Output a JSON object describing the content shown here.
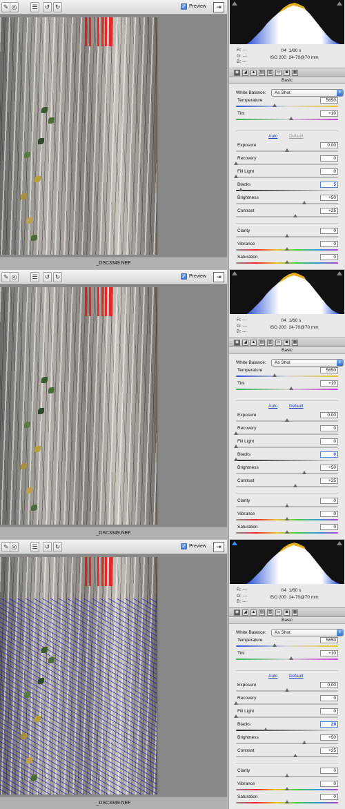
{
  "toolbar": {
    "preview_label": "Preview",
    "preview_checked": true
  },
  "filename": "_DSC3349.NEF",
  "meta": {
    "r": "R:  ---",
    "g": "G:  ---",
    "b": "B:  ---",
    "aperture": "f/4",
    "shutter": "1/60 s",
    "iso": "ISO 200",
    "lens": "24-70@70 mm"
  },
  "basic": {
    "section_title": "Basic",
    "wb_label": "White Balance:",
    "wb_value": "As Shot",
    "auto_label": "Auto",
    "default_label": "Default"
  },
  "panels": [
    {
      "clip_highlight_warning": false,
      "clip_shadow_warning": false,
      "default_enabled": false,
      "sliders": [
        {
          "label": "Temperature",
          "value": "5650",
          "level": 0.38
        },
        {
          "label": "Tint",
          "value": "+10",
          "level": 0.54
        },
        {
          "label": "Exposure",
          "value": "0.00",
          "level": 0.5
        },
        {
          "label": "Recovery",
          "value": "0",
          "level": 0.0
        },
        {
          "label": "Fill Light",
          "value": "0",
          "level": 0.0
        },
        {
          "label": "Blacks",
          "value": "5",
          "level": 0.05,
          "highlight": true
        },
        {
          "label": "Brightness",
          "value": "+50",
          "level": 0.67
        },
        {
          "label": "Contrast",
          "value": "+25",
          "level": 0.58
        },
        {
          "label": "Clarity",
          "value": "0",
          "level": 0.5
        },
        {
          "label": "Vibrance",
          "value": "0",
          "level": 0.5
        },
        {
          "label": "Saturation",
          "value": "0",
          "level": 0.5
        }
      ]
    },
    {
      "clip_highlight_warning": false,
      "clip_shadow_warning": false,
      "default_enabled": true,
      "sliders": [
        {
          "label": "Temperature",
          "value": "5650",
          "level": 0.38
        },
        {
          "label": "Tint",
          "value": "+10",
          "level": 0.54
        },
        {
          "label": "Exposure",
          "value": "0.00",
          "level": 0.5
        },
        {
          "label": "Recovery",
          "value": "0",
          "level": 0.0
        },
        {
          "label": "Fill Light",
          "value": "0",
          "level": 0.0
        },
        {
          "label": "Blacks",
          "value": "0",
          "level": 0.0,
          "highlight": true
        },
        {
          "label": "Brightness",
          "value": "+50",
          "level": 0.67
        },
        {
          "label": "Contrast",
          "value": "+25",
          "level": 0.58
        },
        {
          "label": "Clarity",
          "value": "0",
          "level": 0.5
        },
        {
          "label": "Vibrance",
          "value": "0",
          "level": 0.5
        },
        {
          "label": "Saturation",
          "value": "0",
          "level": 0.5
        }
      ]
    },
    {
      "clip_highlight_warning": false,
      "clip_shadow_warning": true,
      "default_enabled": true,
      "sliders": [
        {
          "label": "Temperature",
          "value": "5650",
          "level": 0.38
        },
        {
          "label": "Tint",
          "value": "+10",
          "level": 0.54
        },
        {
          "label": "Exposure",
          "value": "0.00",
          "level": 0.5
        },
        {
          "label": "Recovery",
          "value": "0",
          "level": 0.0
        },
        {
          "label": "Fill Light",
          "value": "0",
          "level": 0.0
        },
        {
          "label": "Blacks",
          "value": "29",
          "level": 0.29,
          "highlight": true
        },
        {
          "label": "Brightness",
          "value": "+50",
          "level": 0.67
        },
        {
          "label": "Contrast",
          "value": "+25",
          "level": 0.58
        },
        {
          "label": "Clarity",
          "value": "0",
          "level": 0.5
        },
        {
          "label": "Vibrance",
          "value": "0",
          "level": 0.5
        },
        {
          "label": "Saturation",
          "value": "0",
          "level": 0.5
        }
      ]
    }
  ]
}
